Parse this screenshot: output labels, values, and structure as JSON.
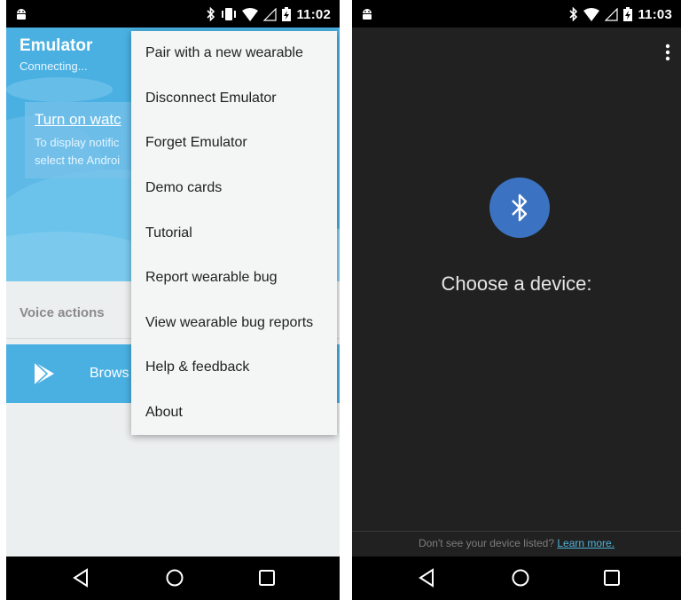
{
  "left_screen": {
    "status_bar": {
      "time": "11:02",
      "icons": [
        "android-icon",
        "bluetooth-icon",
        "vibrate-icon",
        "wifi-icon",
        "signal-icon",
        "battery-charging-icon"
      ]
    },
    "header": {
      "title": "Emulator",
      "subtitle": "Connecting..."
    },
    "notice": {
      "title": "Turn on watc",
      "body_line1": "To display notific",
      "body_line2": "select the Androi"
    },
    "voice_actions_label": "Voice actions",
    "browse_label": "Brows",
    "menu": {
      "items": [
        "Pair with a new wearable",
        "Disconnect Emulator",
        "Forget Emulator",
        "Demo cards",
        "Tutorial",
        "Report wearable bug",
        "View wearable bug reports",
        "Help & feedback",
        "About"
      ]
    },
    "colors": {
      "accent": "#4ab0e2",
      "menu_bg": "#f4f5f5"
    }
  },
  "right_screen": {
    "status_bar": {
      "time": "11:03",
      "icons": [
        "android-icon",
        "bluetooth-icon",
        "wifi-icon",
        "signal-icon",
        "battery-charging-icon"
      ]
    },
    "prompt": "Choose a device:",
    "footer": {
      "text": "Don't see your device listed?",
      "link": "Learn more."
    },
    "colors": {
      "background": "#212121",
      "bluetooth_circle": "#3b72c2",
      "link": "#4fb3d9"
    }
  },
  "nav_icons": [
    "back-icon",
    "home-icon",
    "recents-icon"
  ]
}
